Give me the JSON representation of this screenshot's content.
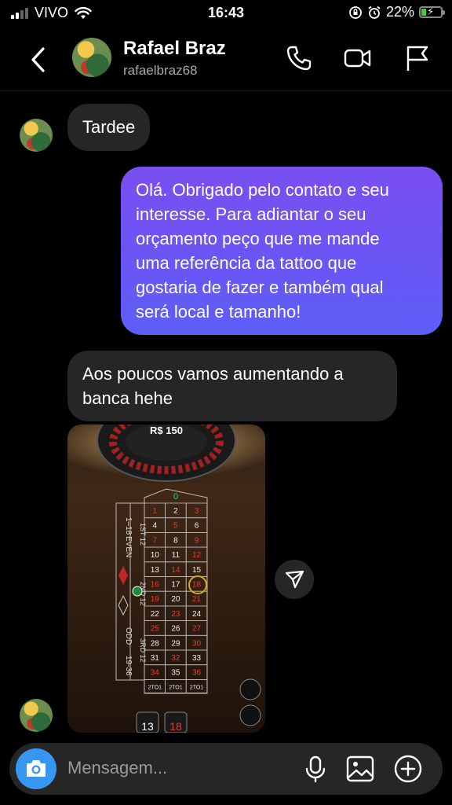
{
  "status": {
    "carrier": "VIVO",
    "time": "16:43",
    "battery": "22%",
    "battery_level": 0.22
  },
  "header": {
    "name": "Rafael Braz",
    "username": "rafaelbraz68"
  },
  "messages": {
    "m1": "Tardee",
    "m2_lines": [
      "Olá. Obrigado pelo contato e seu",
      "interesse. Para adiantar o seu",
      "orçamento peço que me mande",
      "uma referência da tattoo que",
      "gostaria de fazer e também qual",
      "será local e tamanho!"
    ],
    "m3_lines": [
      "Aos poucos vamos aumentando a",
      "banca hehe"
    ]
  },
  "photo": {
    "bet_label": "R$ 150",
    "zero": "0",
    "side_labels": {
      "r1_18": "1–18",
      "even": "EVEN",
      "odd": "ODD",
      "r19_36": "19-36",
      "d1": "1ST 12",
      "d2": "2ND 12",
      "d3": "3RD 12"
    },
    "rows": [
      [
        "1",
        "2",
        "3"
      ],
      [
        "4",
        "5",
        "6"
      ],
      [
        "7",
        "8",
        "9"
      ],
      [
        "10",
        "11",
        "12"
      ],
      [
        "13",
        "14",
        "15"
      ],
      [
        "16",
        "17",
        "18"
      ],
      [
        "19",
        "20",
        "21"
      ],
      [
        "22",
        "23",
        "24"
      ],
      [
        "25",
        "26",
        "27"
      ],
      [
        "28",
        "29",
        "30"
      ],
      [
        "31",
        "32",
        "33"
      ],
      [
        "34",
        "35",
        "36"
      ]
    ],
    "reds": [
      "1",
      "3",
      "5",
      "7",
      "9",
      "12",
      "14",
      "16",
      "18",
      "19",
      "21",
      "23",
      "25",
      "27",
      "30",
      "32",
      "34",
      "36"
    ],
    "column_labels": [
      "2TO1",
      "2TO1",
      "2TO1"
    ],
    "results": [
      "13",
      "18"
    ]
  },
  "composer": {
    "placeholder": "Mensagem..."
  },
  "colors": {
    "accent": "#3797f0",
    "outgoing_start": "#7a4ff0",
    "outgoing_end": "#5d5ff7",
    "incoming": "#262626"
  }
}
